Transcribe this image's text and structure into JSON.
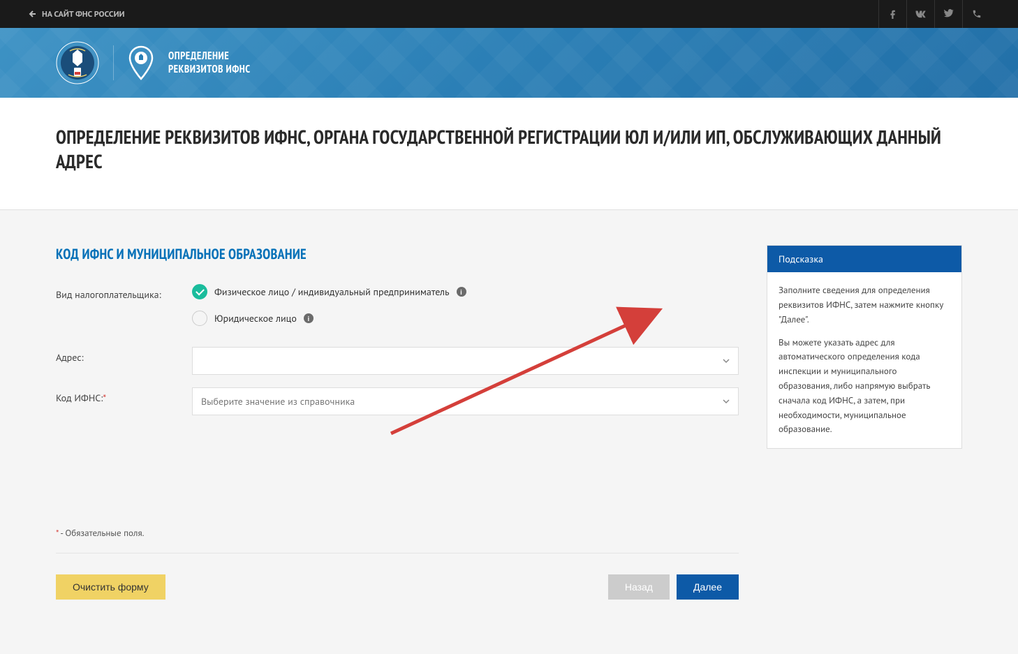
{
  "topbar": {
    "back_link": "НА САЙТ ФНС РОССИИ"
  },
  "header": {
    "title_line1": "ОПРЕДЕЛЕНИЕ",
    "title_line2": "РЕКВИЗИТОВ ИФНС"
  },
  "page": {
    "title": "ОПРЕДЕЛЕНИЕ РЕКВИЗИТОВ ИФНС, ОРГАНА ГОСУДАРСТВЕННОЙ РЕГИСТРАЦИИ ЮЛ И/ИЛИ ИП, ОБСЛУЖИВАЮЩИХ ДАННЫЙ АДРЕС"
  },
  "form": {
    "heading": "КОД ИФНС И МУНИЦИПАЛЬНОЕ ОБРАЗОВАНИЕ",
    "taxpayer_label": "Вид налогоплательщика:",
    "taxpayer_option1": "Физическое лицо / индивидуальный предприниматель",
    "taxpayer_option2": "Юридическое лицо",
    "address_label": "Адрес:",
    "ifns_label": "Код ИФНС:",
    "ifns_required": "*",
    "ifns_placeholder": "Выберите значение из справочника",
    "required_note_prefix": "*",
    "required_note_text": " - Обязательные поля."
  },
  "buttons": {
    "clear": "Очистить форму",
    "back": "Назад",
    "next": "Далее"
  },
  "hint": {
    "title": "Подсказка",
    "p1": "Заполните сведения для определения реквизитов ИФНС, затем нажмите кнопку \"Далее\".",
    "p2": "Вы можете указать адрес для автоматического определения кода инспекции и муниципального образования, либо напрямую выбрать сначала код ИФНС, а затем, при необходимости, муниципальное образование."
  }
}
